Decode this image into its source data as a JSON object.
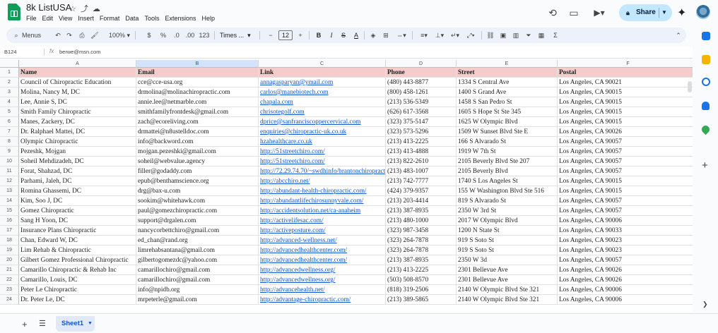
{
  "doc": {
    "title": "8k ListUSA"
  },
  "menus": [
    "File",
    "Edit",
    "View",
    "Insert",
    "Format",
    "Data",
    "Tools",
    "Extensions",
    "Help"
  ],
  "share": {
    "label": "Share"
  },
  "toolbar": {
    "search": "Menus",
    "zoom": "100%",
    "currency": "$",
    "percent": "%",
    "decimal_dec": ".0",
    "decimal_inc": ".00",
    "num_format": "123",
    "font": "Times ...",
    "font_size": "12"
  },
  "formula_bar": {
    "name_box": "B124",
    "fx": "fx",
    "value": "berwe@msn.com"
  },
  "columns": [
    "A",
    "B",
    "C",
    "D",
    "E",
    "F"
  ],
  "selected_column": "B",
  "rows": [
    {
      "n": "1",
      "c": [
        "Name",
        "Email",
        "Link",
        "Phone",
        "Street",
        "Postal"
      ]
    },
    {
      "n": "2",
      "c": [
        "Council of Chiropractic Education",
        "cce@cce-usa.org",
        "annagasparyan@ymail.com",
        "(480) 443-8877",
        "1334 S Central Ave",
        "Los Angeles, CA 90021"
      ]
    },
    {
      "n": "3",
      "c": [
        "Molina, Nancy M, DC",
        "drmolina@molinachiropractic.com",
        "carlos@manebiotech.com",
        "(800) 458-1261",
        "1400 S Grand Ave",
        "Los Angeles, CA 90015"
      ]
    },
    {
      "n": "4",
      "c": [
        "Lee, Annie S, DC",
        "annie.lee@netmarble.com",
        "chapala.com",
        "(213) 536-5349",
        "1458 S San Pedro St",
        "Los Angeles, CA 90015"
      ]
    },
    {
      "n": "5",
      "c": [
        "Smith Family Chiropractic",
        "smithfamilyfrontdesk@gmail.com",
        "chrisotegolf.com",
        "(626) 617-3568",
        "1605 S Hope St Ste 345",
        "Los Angeles, CA 90015"
      ]
    },
    {
      "n": "6",
      "c": [
        "Manes, Zackery, DC",
        "zach@ecoreliving.com",
        "dprice@sanfranciscoppercervical.com",
        "(323) 375-5147",
        "1625 W Olympic Blvd",
        "Los Angeles, CA 90015"
      ]
    },
    {
      "n": "7",
      "c": [
        "Dr. Ralphael Mattei, DC",
        "drmattei@n8ustelldoc.com",
        "enquiries@chiropractic-uk.co.uk",
        "(323) 573-5296",
        "1509 W Sunset Blvd Ste E",
        "Los Angeles, CA 90026"
      ]
    },
    {
      "n": "8",
      "c": [
        "Olympic Chiropractic",
        "info@backword.com",
        "hzahealthcare.co.uk",
        "(213) 413-2225",
        "166 S Alvarado St",
        "Los Angeles, CA 90057"
      ]
    },
    {
      "n": "9",
      "c": [
        "Pezeshk, Mojgan",
        "mojgan.pezeshki@gmail.com",
        "http://51streetchiro.com/",
        "(213) 413-4888",
        "1919 W 7th St",
        "Los Angeles, CA 90057"
      ]
    },
    {
      "n": "10",
      "c": [
        "Soheil Mehdizadeh, DC",
        "soheil@webvalue.agency",
        "http://51streetchiro.com/",
        "(213) 822-2610",
        "2105 Beverly Blvd Ste 207",
        "Los Angeles, CA 90057"
      ]
    },
    {
      "n": "11",
      "c": [
        "Forat, Shahzad, DC",
        "filler@godaddy.com",
        "http://72.29.74.70/~swdhinfo/brantonchiropractic",
        "(213) 483-1007",
        "2105 Beverly Blvd",
        "Los Angeles, CA 90057"
      ]
    },
    {
      "n": "12",
      "c": [
        "Parhami, Jaleh, DC",
        "epub@benthamscience.org",
        "http://abcchiro.net/",
        "(213) 742-7777",
        "1740 S Los Angeles St",
        "Los Angeles, CA 90015"
      ]
    },
    {
      "n": "13",
      "c": [
        "Romina Ghassemi, DC",
        "drg@bax-u.com",
        "http://abundant-health-chiropractic.com/",
        "(424) 379-9357",
        "155 W Washington Blvd Ste 516",
        "Los Angeles, CA 90015"
      ]
    },
    {
      "n": "14",
      "c": [
        "Kim, Soo J, DC",
        "sookim@whitehawk.com",
        "http://abundantlifechirosunnyvale.com/",
        "(213) 203-4414",
        "819 S Alvarado St",
        "Los Angeles, CA 90057"
      ]
    },
    {
      "n": "15",
      "c": [
        "Gomez Chiropractic",
        "paul@gomezchiropractic.com",
        "http://accidentsolution.net/ca-anaheim",
        "(213) 387-8935",
        "2350 W 3rd St",
        "Los Angeles, CA 90057"
      ]
    },
    {
      "n": "16",
      "c": [
        "Sang H Yoon, DC",
        "support@drgalen.com",
        "http://activelifesac.com/",
        "(213) 480-1000",
        "2017 W Olympic Blvd",
        "Los Angeles, CA 90006"
      ]
    },
    {
      "n": "17",
      "c": [
        "Insurance Plans Chiropractic",
        "nancycorbettchiro@gmail.com",
        "http://activeposture.com/",
        "(323) 987-3458",
        "1200 N State St",
        "Los Angeles, CA 90033"
      ]
    },
    {
      "n": "18",
      "c": [
        "Chan, Edward W, DC",
        "ed_chan@rand.org",
        "http://advanced-wellness.net/",
        "(323) 264-7878",
        "919 S Soto St",
        "Los Angeles, CA 90023"
      ]
    },
    {
      "n": "19",
      "c": [
        "Lim Rehab & Chiropractic",
        "limrehabsantana@gmail.com",
        "http://advancedhealthcenter.com/",
        "(323) 264-7878",
        "919 S Soto St",
        "Los Angeles, CA 90023"
      ]
    },
    {
      "n": "20",
      "c": [
        "Gilbert Gomez Professional Chiropractic",
        "gilbertogomezdc@yahoo.com",
        "http://advancedhealthcenter.com/",
        "(213) 387-8935",
        "2350 W 3d",
        "Los Angeles, CA 90057"
      ]
    },
    {
      "n": "21",
      "c": [
        "Camarillo Chiropractic & Rehab Inc",
        "camarillochiro@gmail.com",
        "http://advancedwellness.org/",
        "(213) 413-2225",
        "2301 Bellevue Ave",
        "Los Angeles, CA 90026"
      ]
    },
    {
      "n": "22",
      "c": [
        "Camarillo, Louis, DC",
        "camarillochiro@gmail.com",
        "http://advancedwellness.org/",
        "(503) 508-8570",
        "2301 Bellevue Ave",
        "Los Angeles, CA 90026"
      ]
    },
    {
      "n": "23",
      "c": [
        "Peter Le Chiropractic",
        "info@npidb.org",
        "http://advancehealth.net/",
        "(818) 319-2506",
        "2140 W Olympic Blvd Ste 321",
        "Los Angeles, CA 90006"
      ]
    },
    {
      "n": "24",
      "c": [
        "Dr. Peter Le, DC",
        "mrpeterle@gmail.com",
        "http://advantage-chiropractic.com/",
        "(213) 389-5865",
        "2140 W Olympic Blvd Ste 321",
        "Los Angeles, CA 90006"
      ]
    }
  ],
  "sheets": [
    {
      "name": "Sheet1"
    }
  ]
}
